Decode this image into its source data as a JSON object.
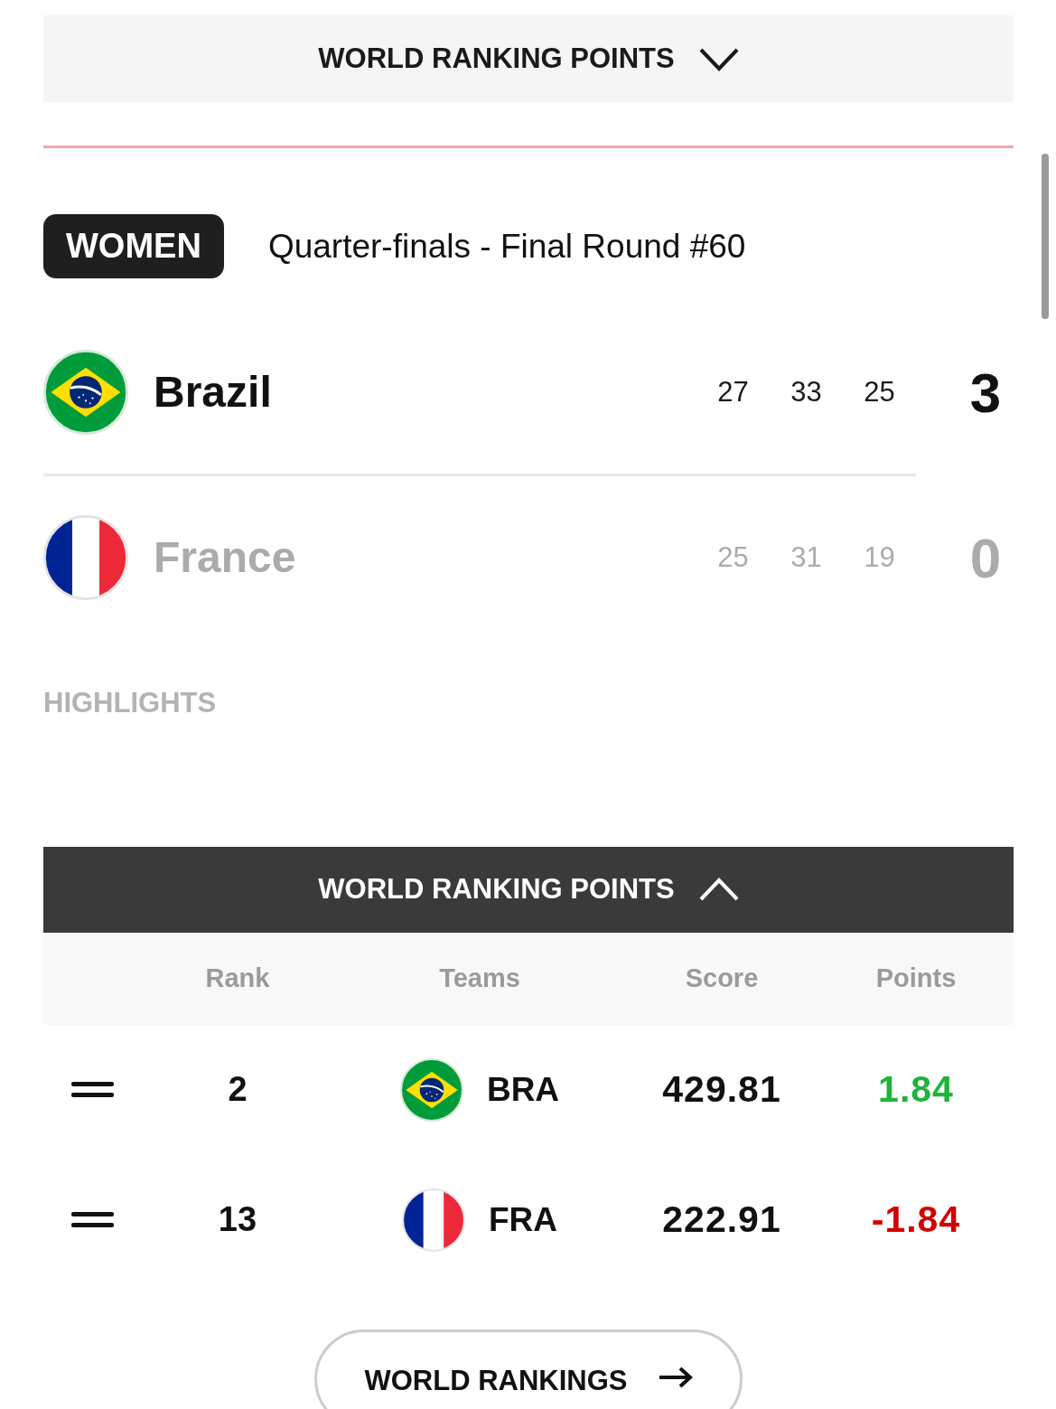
{
  "top_panel": {
    "label": "WORLD RANKING POINTS",
    "expanded": false
  },
  "match": {
    "category": "WOMEN",
    "title": "Quarter-finals - Final Round #60",
    "teams": [
      {
        "name": "Brazil",
        "flag": {
          "kind": "brazil"
        },
        "sets": [
          "27",
          "33",
          "25"
        ],
        "score": "3",
        "winner": true
      },
      {
        "name": "France",
        "flag": {
          "kind": "france"
        },
        "sets": [
          "25",
          "31",
          "19"
        ],
        "score": "0",
        "winner": false
      }
    ]
  },
  "highlights": {
    "heading": "HIGHLIGHTS"
  },
  "ranking": {
    "panel": {
      "label": "WORLD RANKING POINTS",
      "expanded": true
    },
    "columns": [
      "Rank",
      "Teams",
      "Score",
      "Points"
    ],
    "rows": [
      {
        "rank_change": {
          "kind": "same"
        },
        "rank": "2",
        "flag": {
          "kind": "brazil"
        },
        "team": "BRA",
        "score": "429.81",
        "points": "1.84",
        "color": "#1fb33a"
      },
      {
        "rank_change": {
          "kind": "same"
        },
        "rank": "13",
        "flag": {
          "kind": "france"
        },
        "team": "FRA",
        "score": "222.91",
        "points": "-1.84",
        "color": "#d40000"
      }
    ]
  },
  "world_rankings_button": {
    "label": "WORLD RANKINGS"
  }
}
